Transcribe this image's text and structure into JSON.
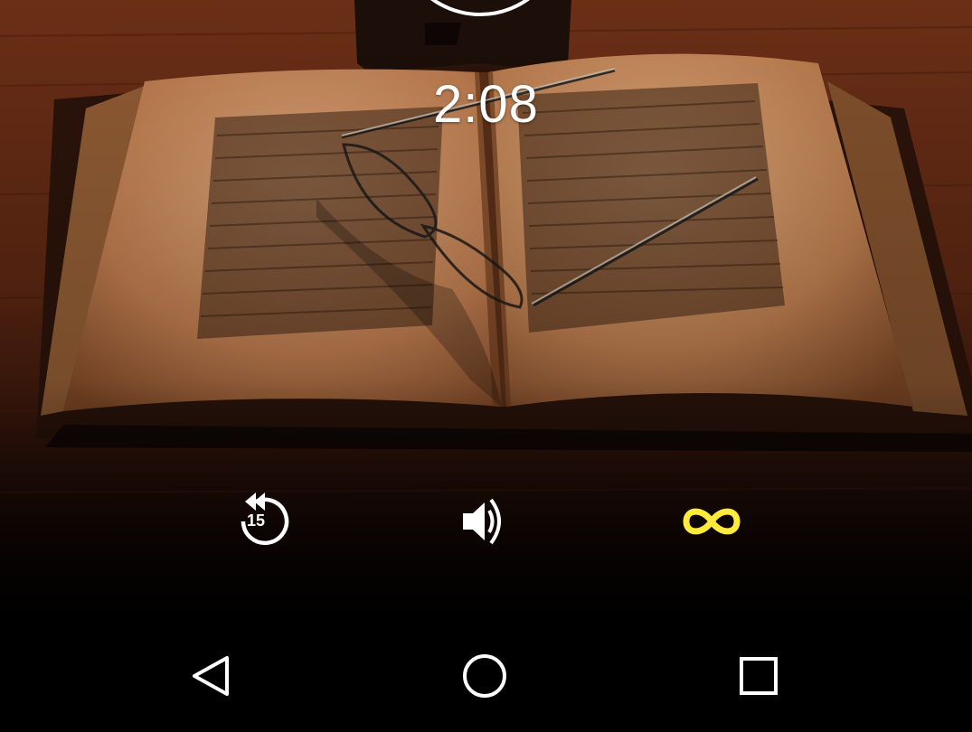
{
  "player": {
    "timer": "2:08",
    "controls": {
      "replay_seconds": "15",
      "loop_color": "#ffeb3b",
      "icons": [
        "replay-15-icon",
        "volume-icon",
        "infinity-loop-icon"
      ]
    }
  },
  "navbar": {
    "icons": [
      "back-triangle-icon",
      "home-circle-icon",
      "recents-square-icon"
    ]
  }
}
